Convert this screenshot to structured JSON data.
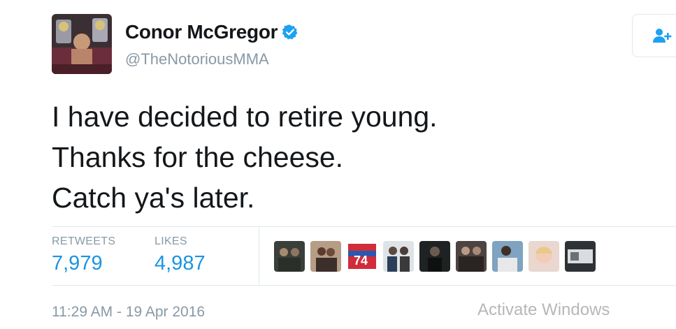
{
  "tweet": {
    "author_name": "Conor McGregor",
    "author_handle": "@TheNotoriousMMA",
    "verified_icon": "verified-badge-icon",
    "lines": [
      "I have decided to retire young.",
      "Thanks for the cheese.",
      "Catch ya's later."
    ],
    "timestamp": "11:29 AM - 19 Apr 2016"
  },
  "stats": {
    "retweets_label": "RETWEETS",
    "retweets_value": "7,979",
    "likes_label": "LIKES",
    "likes_value": "4,987"
  },
  "follow_button": {
    "icon": "follow-user-icon"
  },
  "likers": [
    {
      "icon": "liker-avatar"
    },
    {
      "icon": "liker-avatar"
    },
    {
      "icon": "liker-avatar"
    },
    {
      "icon": "liker-avatar"
    },
    {
      "icon": "liker-avatar"
    },
    {
      "icon": "liker-avatar"
    },
    {
      "icon": "liker-avatar"
    },
    {
      "icon": "liker-avatar"
    },
    {
      "icon": "liker-avatar"
    }
  ],
  "watermark": {
    "title": "Activate Windows"
  },
  "colors": {
    "link_blue": "#1b95e0",
    "verified_blue": "#1da1f2",
    "muted_gray": "#8899a6",
    "text_dark": "#14171a"
  }
}
